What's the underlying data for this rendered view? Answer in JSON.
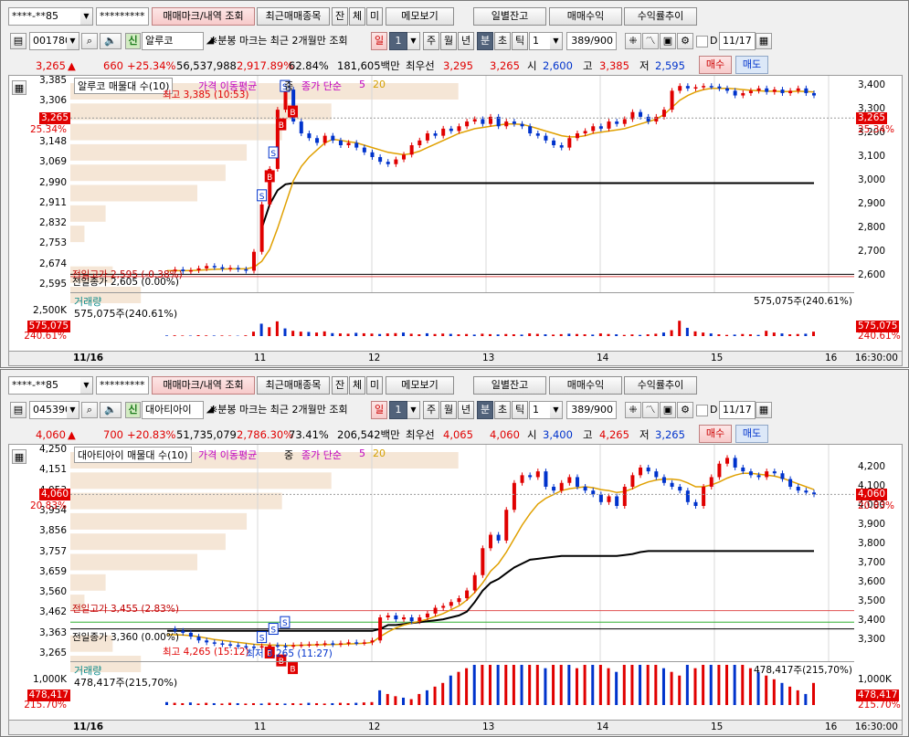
{
  "common": {
    "account_masked": "****-**85",
    "password_masked": "*********",
    "btn_trade_mark": "매매마크/내역 조회",
    "btn_recent": "최근매매종목",
    "btn_jan": "잔",
    "btn_che": "체",
    "btn_mi": "미",
    "btn_memo": "메모보기",
    "btn_daily_balance": "일별잔고",
    "btn_trade_profit": "매매수익",
    "btn_return_trend": "수익률추이",
    "split_note": "※분봉 마크는 최근 2개월만 조회",
    "period_il": "일",
    "period_num": "1",
    "period_ju": "주",
    "period_wol": "월",
    "period_nyeon": "년",
    "period_bun": "분",
    "period_cho": "초",
    "period_tik": "틱",
    "interval_value": "1",
    "count_display": "389/900",
    "date_checkbox_label": "D",
    "date_value": "11/17",
    "btn_buy": "매수",
    "btn_sell": "매도",
    "volume_title": "거래량",
    "footer_time": "16:30:00",
    "x_ticks": [
      "11/16",
      "11",
      "12",
      "13",
      "14",
      "15",
      "16"
    ]
  },
  "panels": [
    {
      "code": "001780",
      "name_badge": "신",
      "name": "알루코",
      "price": "3,265",
      "change_arrow": "▲",
      "change": "660",
      "change_pct": "+25.34%",
      "volume": "56,537,988",
      "volume_pct": "2,917.89%",
      "turnover_rate": "62.84%",
      "amount": "181,605백만",
      "best_label": "최우선",
      "best_ask": "3,295",
      "best_bid": "3,265",
      "open_label": "시",
      "open": "2,600",
      "high_label": "고",
      "high": "3,385",
      "low_label": "저",
      "low": "2,595",
      "legend_name": "알루코 매물대 수(10)",
      "legend_ma": "가격 이동평균",
      "legend_mid": "중",
      "legend_close": "종가 단순",
      "legend_5": "5",
      "legend_20": "20",
      "high_note": "최고 3,385 (10:53)",
      "low_note": "",
      "prev_high_note": "전일고가 2,595 (-0.38%)",
      "prev_close_note": "전일종가 2,605 (0.00%)",
      "prev_low_note": "",
      "left_y": [
        "3,385",
        "3,306",
        "3,227",
        "3,148",
        "3,069",
        "2,990",
        "2,911",
        "2,832",
        "2,753",
        "2,674",
        "2,595"
      ],
      "right_y": [
        "3,400",
        "3,300",
        "3,200",
        "3,100",
        "3,000",
        "2,900",
        "2,800",
        "2,700",
        "2,600"
      ],
      "tag_price": "3,265",
      "tag_pct": "25.34%",
      "vol_left_y": "2,500K",
      "vol_right_y": "",
      "vol_tag": "575,075",
      "vol_tag_pct": "240.61%",
      "vol_note": "575,075주(240.61%)",
      "vol_corner": "575,075주(240.61%)",
      "chart_data": {
        "type": "line",
        "series": [
          {
            "name": "5",
            "values": []
          },
          {
            "name": "20",
            "values": []
          }
        ],
        "y_range": [
          2560,
          3420
        ],
        "price_path": [
          2620,
          2625,
          2618,
          2622,
          2630,
          2640,
          2635,
          2628,
          2632,
          2626,
          2620,
          2700,
          2900,
          3050,
          3300,
          3385,
          3250,
          3200,
          3180,
          3160,
          3190,
          3170,
          3150,
          3160,
          3140,
          3120,
          3100,
          3080,
          3070,
          3090,
          3110,
          3150,
          3170,
          3200,
          3190,
          3220,
          3210,
          3230,
          3250,
          3260,
          3240,
          3270,
          3230,
          3250,
          3240,
          3230,
          3200,
          3190,
          3170,
          3150,
          3140,
          3180,
          3200,
          3210,
          3230,
          3220,
          3250,
          3240,
          3260,
          3290,
          3270,
          3250,
          3270,
          3300,
          3380,
          3400,
          3390,
          3395,
          3400,
          3398,
          3390,
          3380,
          3360,
          3370,
          3380,
          3390,
          3375,
          3385,
          3370,
          3380,
          3390,
          3370,
          3360
        ],
        "ma20_path": [
          2620,
          2620,
          2620,
          2621,
          2622,
          2624,
          2626,
          2627,
          2628,
          2628,
          2628,
          2635,
          2660,
          2710,
          2800,
          2900,
          3000,
          3060,
          3100,
          3130,
          3160,
          3175,
          3170,
          3165,
          3160,
          3150,
          3140,
          3130,
          3120,
          3115,
          3110,
          3115,
          3125,
          3140,
          3155,
          3170,
          3185,
          3200,
          3210,
          3220,
          3225,
          3230,
          3235,
          3240,
          3240,
          3238,
          3230,
          3220,
          3210,
          3200,
          3190,
          3185,
          3185,
          3190,
          3200,
          3205,
          3210,
          3215,
          3220,
          3230,
          3240,
          3250,
          3260,
          3280,
          3310,
          3340,
          3360,
          3375,
          3385,
          3390,
          3390,
          3390,
          3388,
          3385,
          3382,
          3380,
          3378,
          3378,
          3377,
          3377,
          3378,
          3377,
          3375
        ],
        "black_path": [
          null,
          null,
          null,
          null,
          null,
          null,
          null,
          null,
          null,
          null,
          null,
          null,
          2800,
          2900,
          2960,
          2985,
          2990,
          2990,
          2990,
          2990,
          2990,
          2990,
          2990,
          2990,
          2990,
          2990,
          2990,
          2990,
          2990,
          2990,
          2990,
          2990,
          2990,
          2990,
          2990,
          2990,
          2990,
          2990,
          2990,
          2990,
          2990,
          2990,
          2990,
          2990,
          2990,
          2990,
          2990,
          2990,
          2990,
          2990,
          2990,
          2990,
          2990,
          2990,
          2990,
          2990,
          2990,
          2990,
          2990,
          2990,
          2990,
          2990,
          2990,
          2990,
          2990,
          2990,
          2990,
          2990,
          2990,
          2990,
          2990,
          2990,
          2990,
          2990,
          2990,
          2990,
          2990,
          2990,
          2990,
          2990,
          2990,
          2990,
          2990
        ],
        "volume_bars": [
          20,
          25,
          18,
          15,
          30,
          22,
          18,
          20,
          15,
          12,
          25,
          150,
          420,
          300,
          500,
          260,
          180,
          150,
          140,
          120,
          160,
          100,
          90,
          80,
          110,
          95,
          85,
          70,
          90,
          100,
          120,
          80,
          60,
          95,
          70,
          85,
          75,
          60,
          70,
          50,
          80,
          65,
          55,
          70,
          60,
          50,
          90,
          75,
          60,
          50,
          65,
          80,
          70,
          60,
          50,
          90,
          70,
          60,
          40,
          55,
          40,
          60,
          80,
          120,
          200,
          520,
          280,
          160,
          120,
          90,
          60,
          40,
          50,
          70,
          60,
          40,
          180,
          120,
          90,
          60,
          70,
          80,
          150
        ],
        "volume_scale_max": 3000,
        "prev_high": 2595,
        "prev_close": 2605,
        "prev_low": null
      }
    },
    {
      "code": "045390",
      "name_badge": "신",
      "name": "대아티아이",
      "price": "4,060",
      "change_arrow": "▲",
      "change": "700",
      "change_pct": "+20.83%",
      "volume": "51,735,079",
      "volume_pct": "2,786.30%",
      "turnover_rate": "73.41%",
      "amount": "206,542백만",
      "best_label": "최우선",
      "best_ask": "4,065",
      "best_bid": "4,060",
      "open_label": "시",
      "open": "3,400",
      "high_label": "고",
      "high": "4,265",
      "low_label": "저",
      "low": "3,265",
      "legend_name": "대아티아이 매물대 수(10)",
      "legend_ma": "가격 이동평균",
      "legend_mid": "중",
      "legend_close": "종가 단순",
      "legend_5": "5",
      "legend_20": "20",
      "high_note": "최고 4,265 (15:12)",
      "low_note": "최저 3,265 (11:27)",
      "prev_high_note": "전일고가 3,455 (2.83%)",
      "prev_close_note": "전일종가 3,360 (0.00%)",
      "prev_low_note": "",
      "left_y": [
        "4,250",
        "4,151",
        "4,053",
        "3,954",
        "3,856",
        "3,757",
        "3,659",
        "3,560",
        "3,462",
        "3,363",
        "3,265"
      ],
      "right_y": [
        "4,200",
        "4,100",
        "4,000",
        "3,900",
        "3,800",
        "3,700",
        "3,600",
        "3,500",
        "3,400",
        "3,300"
      ],
      "tag_price": "4,060",
      "tag_pct": "20.83%",
      "vol_left_y": "1,000K",
      "vol_right_y": "1,000K",
      "vol_tag": "478,417",
      "vol_tag_pct": "215.70%",
      "vol_note": "478,417주(215,70%)",
      "vol_corner": "478,417주(215,70%)",
      "chart_data": {
        "type": "line",
        "series": [
          {
            "name": "5",
            "values": []
          },
          {
            "name": "20",
            "values": []
          }
        ],
        "y_range": [
          3230,
          4290
        ],
        "price_path": [
          3360,
          3350,
          3340,
          3320,
          3300,
          3290,
          3285,
          3280,
          3275,
          3270,
          3268,
          3265,
          3270,
          3275,
          3272,
          3270,
          3275,
          3278,
          3280,
          3282,
          3285,
          3280,
          3285,
          3290,
          3288,
          3290,
          3300,
          3420,
          3430,
          3410,
          3420,
          3400,
          3420,
          3440,
          3470,
          3480,
          3500,
          3520,
          3560,
          3640,
          3780,
          3850,
          3820,
          3980,
          4120,
          4160,
          4150,
          4180,
          4100,
          4080,
          4120,
          4150,
          4100,
          4080,
          4060,
          4020,
          4050,
          4000,
          4100,
          4160,
          4200,
          4180,
          4150,
          4120,
          4100,
          4080,
          4020,
          4000,
          4100,
          4150,
          4220,
          4250,
          4200,
          4180,
          4160,
          4150,
          4180,
          4170,
          4140,
          4100,
          4080,
          4070,
          4060
        ],
        "ma20_path": [
          3330,
          3330,
          3328,
          3325,
          3320,
          3312,
          3305,
          3300,
          3295,
          3290,
          3285,
          3280,
          3278,
          3276,
          3275,
          3274,
          3274,
          3275,
          3276,
          3277,
          3278,
          3279,
          3280,
          3282,
          3283,
          3285,
          3290,
          3320,
          3345,
          3365,
          3380,
          3390,
          3400,
          3410,
          3425,
          3440,
          3460,
          3480,
          3510,
          3550,
          3600,
          3660,
          3700,
          3760,
          3830,
          3900,
          3960,
          4010,
          4040,
          4060,
          4080,
          4090,
          4095,
          4100,
          4095,
          4085,
          4080,
          4070,
          4075,
          4090,
          4110,
          4125,
          4135,
          4140,
          4140,
          4135,
          4120,
          4100,
          4100,
          4110,
          4125,
          4145,
          4160,
          4170,
          4170,
          4165,
          4160,
          4155,
          4145,
          4130,
          4115,
          4100,
          4085
        ],
        "black_path": [
          3350,
          3350,
          3350,
          3350,
          3350,
          3350,
          3350,
          3350,
          3350,
          3350,
          3350,
          3350,
          3350,
          3350,
          3350,
          3350,
          3350,
          3350,
          3350,
          3350,
          3350,
          3350,
          3350,
          3350,
          3350,
          3350,
          3350,
          3360,
          3380,
          3380,
          3385,
          3390,
          3395,
          3400,
          3405,
          3410,
          3420,
          3430,
          3450,
          3500,
          3560,
          3600,
          3620,
          3650,
          3680,
          3700,
          3720,
          3725,
          3730,
          3735,
          3740,
          3740,
          3740,
          3740,
          3740,
          3740,
          3740,
          3740,
          3745,
          3750,
          3760,
          3765,
          3765,
          3765,
          3765,
          3765,
          3765,
          3765,
          3765,
          3765,
          3765,
          3765,
          3765,
          3765,
          3765,
          3765,
          3765,
          3765,
          3765,
          3765,
          3765,
          3765,
          3765
        ],
        "volume_bars": [
          40,
          30,
          25,
          35,
          20,
          30,
          25,
          20,
          30,
          25,
          20,
          25,
          20,
          30,
          25,
          20,
          25,
          20,
          30,
          25,
          20,
          25,
          30,
          25,
          30,
          35,
          40,
          200,
          150,
          120,
          100,
          80,
          150,
          200,
          250,
          300,
          400,
          450,
          500,
          900,
          1000,
          1050,
          800,
          900,
          850,
          700,
          600,
          650,
          500,
          550,
          700,
          600,
          500,
          650,
          700,
          550,
          500,
          450,
          900,
          1050,
          800,
          700,
          600,
          500,
          450,
          400,
          650,
          500,
          750,
          900,
          850,
          700,
          600,
          550,
          500,
          450,
          400,
          350,
          300,
          250,
          200,
          150,
          300
        ],
        "volume_scale_max": 1200,
        "prev_high": 3455,
        "prev_close": 3360,
        "prev_low": 3395
      }
    }
  ]
}
